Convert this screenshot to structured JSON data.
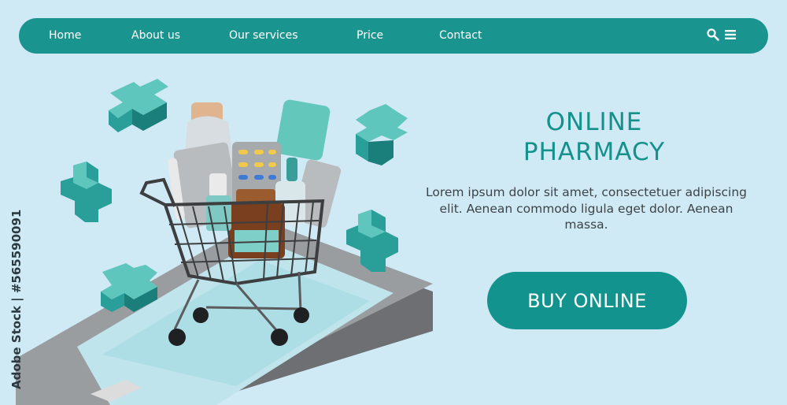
{
  "nav": {
    "items": [
      {
        "label": "Home"
      },
      {
        "label": "About us"
      },
      {
        "label": "Our services"
      },
      {
        "label": "Price"
      },
      {
        "label": "Contact"
      }
    ],
    "icons": [
      "search-icon",
      "menu-icon"
    ]
  },
  "hero": {
    "title_line1": "ONLINE",
    "title_line2": "PHARMACY",
    "description": "Lorem ipsum dolor sit amet, consectetuer adipiscing elit. Aenean commodo ligula eget dolor. Aenean massa.",
    "button_label": "BUY ONLINE"
  },
  "watermark": {
    "stock_id": "Adobe Stock | #565590091"
  },
  "colors": {
    "background": "#cfe9f5",
    "brand": "#1a948f",
    "text": "#3d4448"
  }
}
